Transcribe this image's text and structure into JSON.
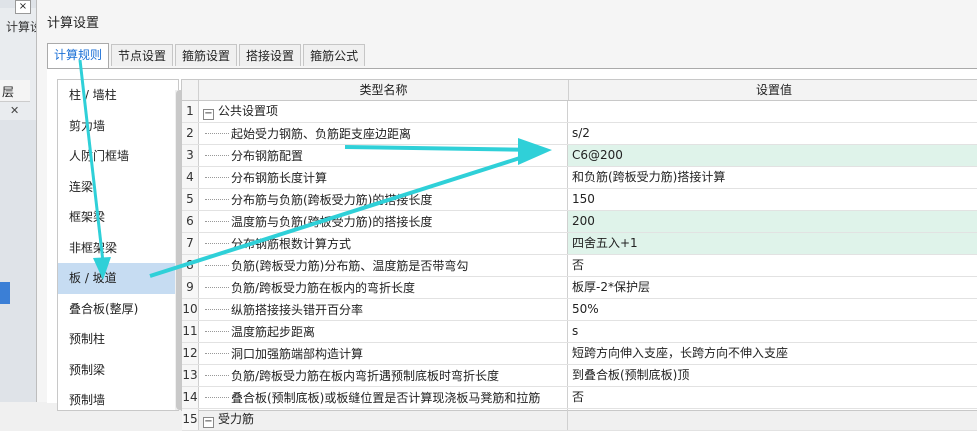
{
  "background": {
    "label": "计算设",
    "layer_label": "层",
    "close_glyph": "×",
    "x_glyph": "✕"
  },
  "dialog": {
    "title": "计算设置",
    "tabs": [
      {
        "label": "计算规则",
        "active": true
      },
      {
        "label": "节点设置",
        "active": false
      },
      {
        "label": "箍筋设置",
        "active": false
      },
      {
        "label": "搭接设置",
        "active": false
      },
      {
        "label": "箍筋公式",
        "active": false
      }
    ]
  },
  "left_list": {
    "items": [
      {
        "label": "柱 / 墙柱"
      },
      {
        "label": "剪力墙"
      },
      {
        "label": "人防门框墙"
      },
      {
        "label": "连梁"
      },
      {
        "label": "框架梁"
      },
      {
        "label": "非框架梁"
      },
      {
        "label": "板 / 坡道",
        "selected": true
      },
      {
        "label": "叠合板(整厚)"
      },
      {
        "label": "预制柱"
      },
      {
        "label": "预制梁"
      },
      {
        "label": "预制墙"
      }
    ]
  },
  "grid": {
    "header_name": "类型名称",
    "header_value": "设置值",
    "rows": [
      {
        "num": "1",
        "name": "公共设置项",
        "value": "",
        "group": true,
        "toggle": "−"
      },
      {
        "num": "2",
        "name": "起始受力钢筋、负筋距支座边距离",
        "value": "s/2"
      },
      {
        "num": "3",
        "name": "分布钢筋配置",
        "value": "C6@200",
        "hl": true
      },
      {
        "num": "4",
        "name": "分布钢筋长度计算",
        "value": "和负筋(跨板受力筋)搭接计算"
      },
      {
        "num": "5",
        "name": "分布筋与负筋(跨板受力筋)的搭接长度",
        "value": "150"
      },
      {
        "num": "6",
        "name": "温度筋与负筋(跨板受力筋)的搭接长度",
        "value": "200",
        "hl": true
      },
      {
        "num": "7",
        "name": "分布钢筋根数计算方式",
        "value": "四舍五入+1",
        "hl": true
      },
      {
        "num": "8",
        "name": "负筋(跨板受力筋)分布筋、温度筋是否带弯勾",
        "value": "否"
      },
      {
        "num": "9",
        "name": "负筋/跨板受力筋在板内的弯折长度",
        "value": "板厚-2*保护层"
      },
      {
        "num": "10",
        "name": "纵筋搭接接头错开百分率",
        "value": "50%"
      },
      {
        "num": "11",
        "name": "温度筋起步距离",
        "value": "s"
      },
      {
        "num": "12",
        "name": "洞口加强筋端部构造计算",
        "value": "短跨方向伸入支座，长跨方向不伸入支座"
      },
      {
        "num": "13",
        "name": "负筋/跨板受力筋在板内弯折遇预制底板时弯折长度",
        "value": "到叠合板(预制底板)顶"
      },
      {
        "num": "14",
        "name": "叠合板(预制底板)或板缝位置是否计算现浇板马凳筋和拉筋",
        "value": "否"
      },
      {
        "num": "15",
        "name": "受力筋",
        "value": "",
        "group": true,
        "toggle": "−"
      }
    ]
  },
  "annotation": {
    "arrow_color": "#2fd0d8"
  }
}
